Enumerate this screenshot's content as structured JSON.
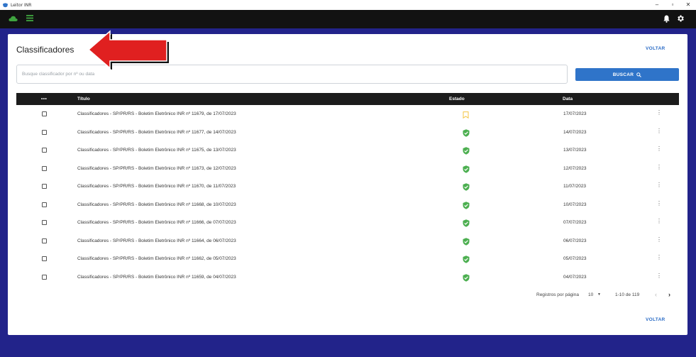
{
  "window": {
    "title": "Leitor INR",
    "controls": {
      "minimize": "–",
      "maximize": "▫",
      "close": "✕"
    }
  },
  "colors": {
    "page_bg": "#22238a",
    "appbar_bg": "#121212",
    "accent_blue": "#2f74c9",
    "status_green": "#4caf50",
    "status_yellow": "#f4c542",
    "annotation_arrow": "#e02020"
  },
  "appbar": {
    "left_icons": [
      "cloud-icon",
      "menu-icon"
    ],
    "right_icons": [
      "bell-icon",
      "gear-icon"
    ]
  },
  "page": {
    "title": "Classificadores",
    "back_label": "VOLTAR",
    "back_label_bottom": "VOLTAR"
  },
  "search": {
    "placeholder": "Busque classificador por nº ou data",
    "value": "",
    "button_label": "BUSCAR",
    "button_icon": "search-icon"
  },
  "table": {
    "headers": {
      "select": "•••",
      "title": "Título",
      "status": "Estado",
      "date": "Data"
    },
    "rows": [
      {
        "title": "Classificadores - SP/PR/RS - Boletim Eletrônico INR nº 11679, de 17/07/2023",
        "status": "bookmark-outline-icon",
        "date": "17/07/2023",
        "checked": false
      },
      {
        "title": "Classificadores - SP/PR/RS - Boletim Eletrônico INR nº 11677, de 14/07/2023",
        "status": "verified-shield-icon",
        "date": "14/07/2023",
        "checked": false
      },
      {
        "title": "Classificadores - SP/PR/RS - Boletim Eletrônico INR nº 11675, de 13/07/2023",
        "status": "verified-shield-icon",
        "date": "13/07/2023",
        "checked": false
      },
      {
        "title": "Classificadores - SP/PR/RS - Boletim Eletrônico INR nº 11673, de 12/07/2023",
        "status": "verified-shield-icon",
        "date": "12/07/2023",
        "checked": false
      },
      {
        "title": "Classificadores - SP/PR/RS - Boletim Eletrônico INR nº 11670, de 11/07/2023",
        "status": "verified-shield-icon",
        "date": "11/07/2023",
        "checked": false
      },
      {
        "title": "Classificadores - SP/PR/RS - Boletim Eletrônico INR nº 11668, de 10/07/2023",
        "status": "verified-shield-icon",
        "date": "10/07/2023",
        "checked": false
      },
      {
        "title": "Classificadores - SP/PR/RS - Boletim Eletrônico INR nº 11666, de 07/07/2023",
        "status": "verified-shield-icon",
        "date": "07/07/2023",
        "checked": false
      },
      {
        "title": "Classificadores - SP/PR/RS - Boletim Eletrônico INR nº 11664, de 06/07/2023",
        "status": "verified-shield-icon",
        "date": "06/07/2023",
        "checked": false
      },
      {
        "title": "Classificadores - SP/PR/RS - Boletim Eletrônico INR nº 11662, de 05/07/2023",
        "status": "verified-shield-icon",
        "date": "05/07/2023",
        "checked": false
      },
      {
        "title": "Classificadores - SP/PR/RS - Boletim Eletrônico INR nº 11659, de 04/07/2023",
        "status": "verified-shield-icon",
        "date": "04/07/2023",
        "checked": false
      }
    ],
    "row_menu_icon": "kebab-menu-icon"
  },
  "pagination": {
    "rows_per_page_label": "Registros por página",
    "rows_per_page": "10",
    "range": "1-10 de 119",
    "prev_icon": "chevron-left-icon",
    "next_icon": "chevron-right-icon"
  },
  "annotation": {
    "icon": "red-arrow-pointer"
  }
}
